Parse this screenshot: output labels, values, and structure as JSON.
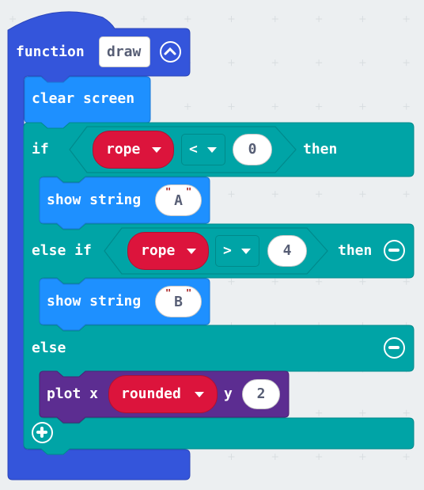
{
  "colors": {
    "function_block": "#3455db",
    "basic_block": "#1e90ff",
    "logic_block": "#00a4a6",
    "variable_pill": "#dc143c",
    "led_block": "#5c2d91",
    "background": "#eceff1"
  },
  "function": {
    "keyword": "function",
    "name": "draw",
    "collapse_icon": "chevron-up-circle-icon"
  },
  "clear_screen": {
    "label": "clear screen"
  },
  "if_block": {
    "if_label": "if",
    "then_label": "then",
    "condition": {
      "variable": "rope",
      "operator": "<",
      "value": "0"
    },
    "body": {
      "label": "show string",
      "value": "A"
    }
  },
  "else_if_block": {
    "label": "else if",
    "then_label": "then",
    "condition": {
      "variable": "rope",
      "operator": ">",
      "value": "4"
    },
    "remove_icon": "minus-circle-icon",
    "body": {
      "label": "show string",
      "value": "B"
    }
  },
  "else_block": {
    "label": "else",
    "remove_icon": "minus-circle-icon",
    "body": {
      "plot_label": "plot x",
      "x_variable": "rounded",
      "y_label": "y",
      "y_value": "2"
    }
  },
  "add_icon": "plus-circle-icon"
}
